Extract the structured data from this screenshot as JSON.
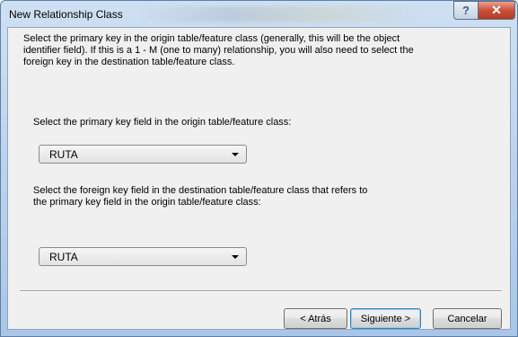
{
  "window": {
    "title": "New Relationship Class",
    "help_glyph": "?",
    "close_glyph": "✕"
  },
  "content": {
    "intro": "Select the primary key in the origin table/feature class (generally, this will be the object identifier field). If this is a 1 - M (one to many) relationship, you will also need to select the foreign key in the destination table/feature class.",
    "primary_key_label": "Select the primary key field in the origin table/feature class:",
    "primary_key_value": "RUTA",
    "foreign_key_label": "Select the foreign key field in the destination table/feature class that refers to the primary key field in the origin table/feature class:",
    "foreign_key_value": "RUTA"
  },
  "buttons": {
    "back": "< Atrás",
    "next": "Siguiente >",
    "cancel": "Cancelar"
  }
}
